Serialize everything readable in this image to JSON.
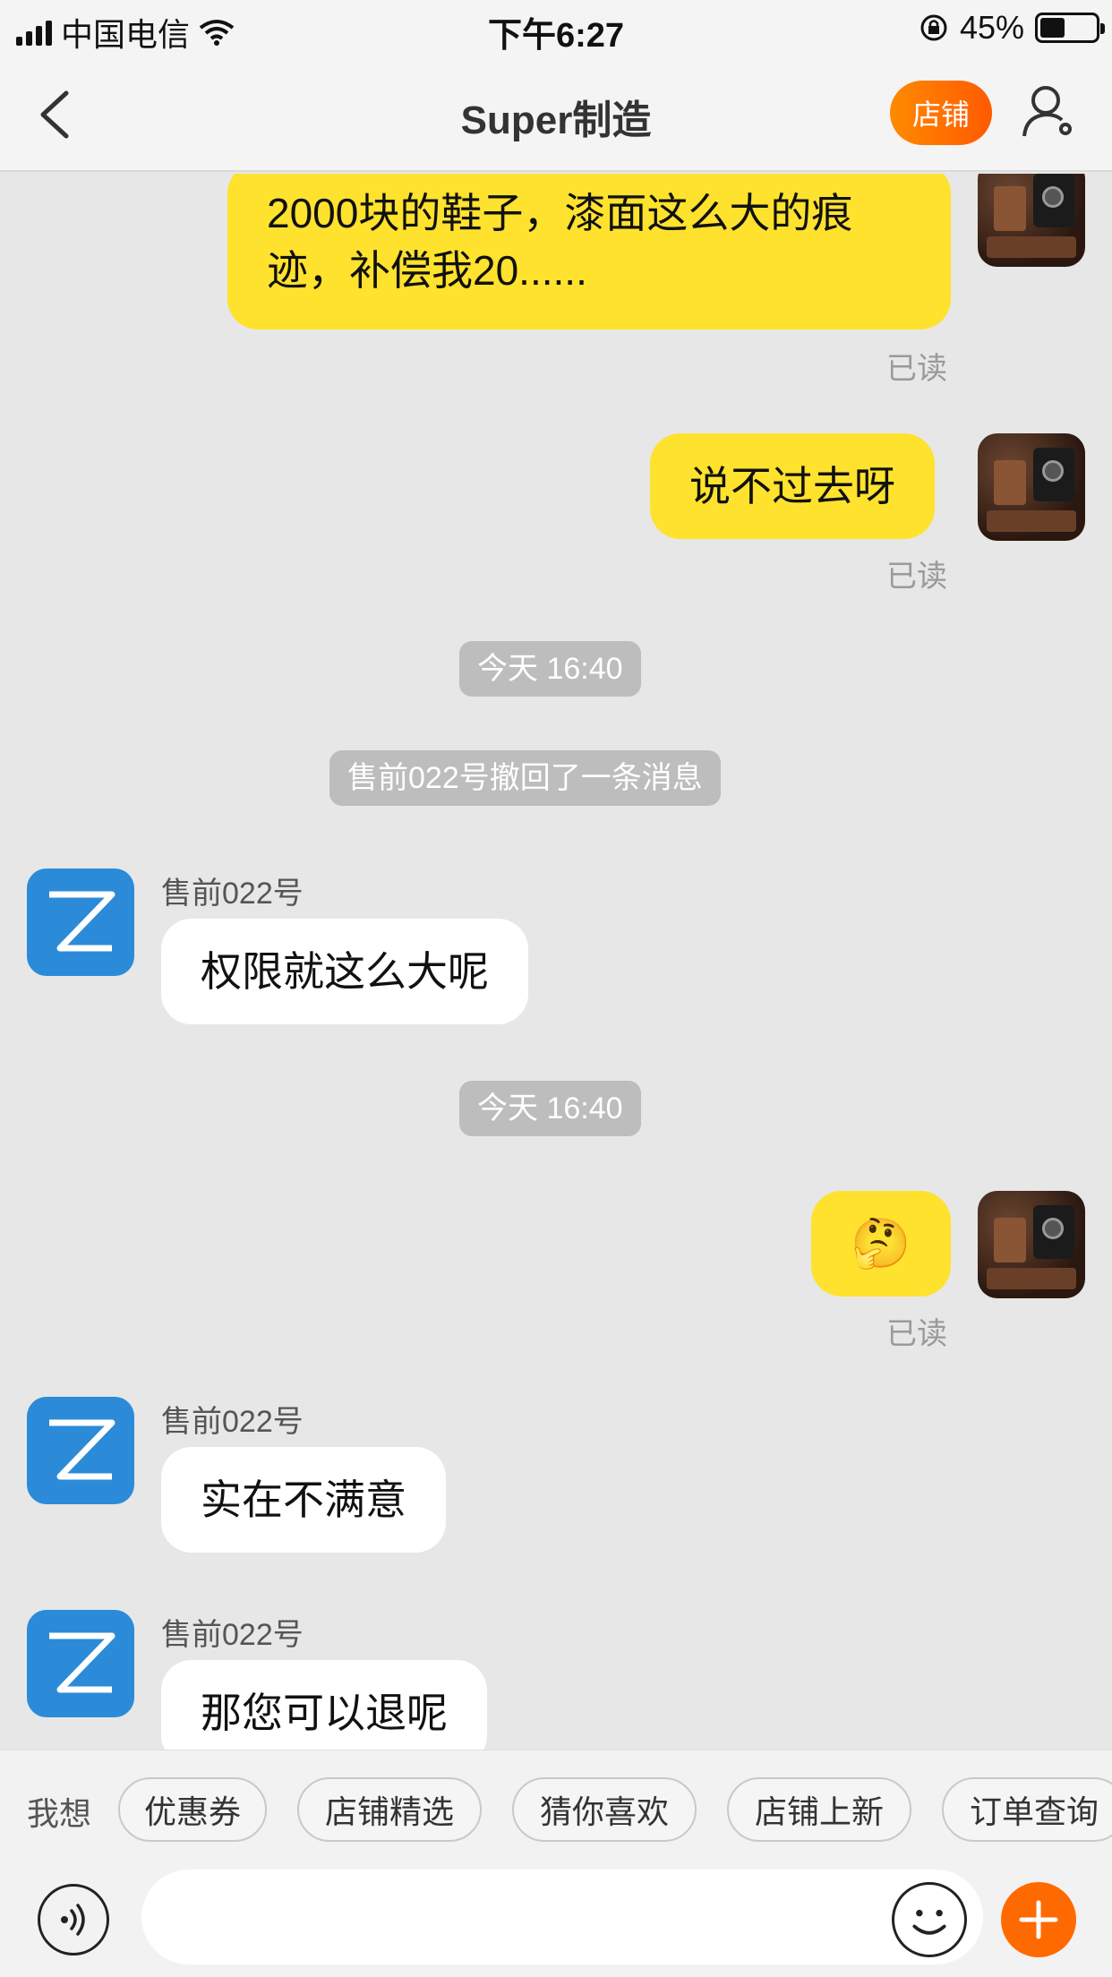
{
  "status_bar": {
    "carrier": "中国电信",
    "time": "下午6:27",
    "battery": "45%",
    "battery_level": 0.45
  },
  "header": {
    "title": "Super制造",
    "store_label": "店铺"
  },
  "messages": {
    "m1": {
      "line1": "2000块的鞋子，漆面这么大的痕",
      "line2": "迹，补偿我20......",
      "status": "已读"
    },
    "m2": {
      "text": "说不过去呀",
      "status": "已读"
    },
    "ts1": "今天 16:40",
    "recall_notice": "售前022号撤回了一条消息",
    "m3": {
      "sender": "售前022号",
      "text": "权限就这么大呢"
    },
    "ts2": "今天 16:40",
    "m4": {
      "emoji": "🤔",
      "status": "已读"
    },
    "m5": {
      "sender": "售前022号",
      "text": "实在不满意"
    },
    "m6": {
      "sender": "售前022号",
      "text": "那您可以退呢"
    }
  },
  "quick_bar": {
    "label": "我想",
    "chips": [
      "优惠券",
      "店铺精选",
      "猜你喜欢",
      "店铺上新",
      "订单查询"
    ]
  },
  "input": {
    "placeholder": ""
  },
  "icons": {
    "back": "chevron-left-icon",
    "user_settings": "user-settings-icon",
    "voice": "voice-icon",
    "emoji": "smiley-icon",
    "plus": "plus-icon"
  },
  "colors": {
    "accent": "#ff6a00",
    "bubble_mine": "#ffe22d",
    "bot_avatar": "#2b8bd8"
  }
}
